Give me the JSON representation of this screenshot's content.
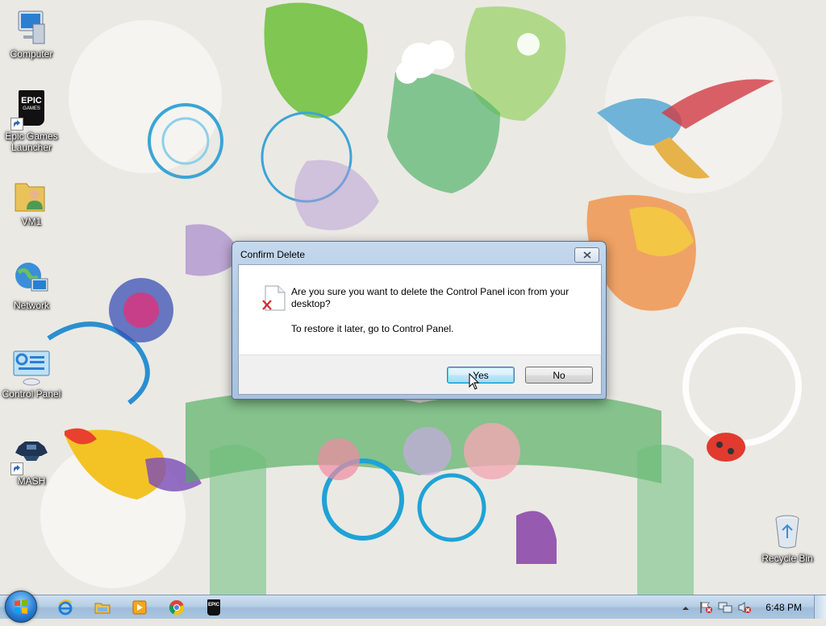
{
  "desktop": {
    "icons": [
      {
        "label": "Computer",
        "icon": "computer-icon",
        "shortcut": false
      },
      {
        "label": "Epic Games Launcher",
        "icon": "epic-games-icon",
        "shortcut": true,
        "logo_text_1": "EPIC",
        "logo_text_2": "GAMES"
      },
      {
        "label": "VM1",
        "icon": "user-folder-icon",
        "shortcut": false
      },
      {
        "label": "Network",
        "icon": "network-icon",
        "shortcut": false
      },
      {
        "label": "Control Panel",
        "icon": "control-panel-icon",
        "shortcut": false
      },
      {
        "label": "MASH",
        "icon": "mash-icon",
        "shortcut": true
      },
      {
        "label": "Recycle Bin",
        "icon": "recycle-bin-icon",
        "shortcut": false
      }
    ]
  },
  "dialog": {
    "title": "Confirm Delete",
    "close_icon": "close-icon",
    "message": "Are you sure you want to delete the Control Panel icon from your desktop?",
    "hint": "To restore it later, go to Control Panel.",
    "yes_label": "Yes",
    "no_label": "No"
  },
  "taskbar": {
    "start_icon": "windows-start-orb-icon",
    "pinned": [
      {
        "name": "internet-explorer-icon"
      },
      {
        "name": "file-explorer-icon"
      },
      {
        "name": "media-player-icon"
      },
      {
        "name": "chrome-icon"
      },
      {
        "name": "epic-games-taskbar-icon",
        "text": "EPIC"
      }
    ],
    "tray": {
      "icons": [
        "show-hidden-icons-arrow",
        "action-center-flag-icon",
        "network-tray-icon",
        "volume-muted-icon"
      ],
      "time": "6:48 PM"
    }
  },
  "colors": {
    "dialog_frame": "#b1c9e3",
    "taskbar": "#b6cfe6",
    "default_button": "#bee6fd"
  }
}
